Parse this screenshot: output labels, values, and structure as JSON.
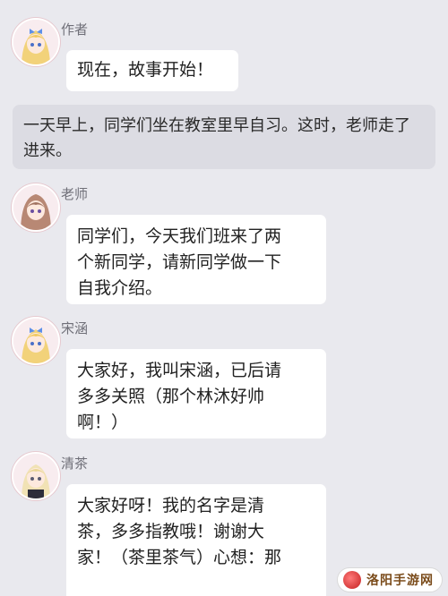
{
  "messages": [
    {
      "speaker": "作者",
      "text": "现在，故事开始！"
    },
    {
      "narration": "一天早上，同学们坐在教室里早自习。这时，老师走了进来。"
    },
    {
      "speaker": "老师",
      "lines": [
        "同学们，今天我们班来了两",
        "个新同学，请新同学做一下",
        "自我介绍。"
      ]
    },
    {
      "speaker": "宋涵",
      "lines": [
        "大家好，我叫宋涵，已后请",
        "多多关照（那个林沐好帅",
        "啊！）"
      ]
    },
    {
      "speaker": "清茶",
      "lines": [
        "大家好呀！我的名字是清",
        "茶，多多指教哦！谢谢大",
        "家！（茶里茶气）心想：那"
      ]
    }
  ],
  "watermark": {
    "text": "洛阳手游网"
  },
  "colors": {
    "background": "#e9e9ee",
    "bubble": "#ffffff",
    "narration_bg": "#dcdce3"
  }
}
